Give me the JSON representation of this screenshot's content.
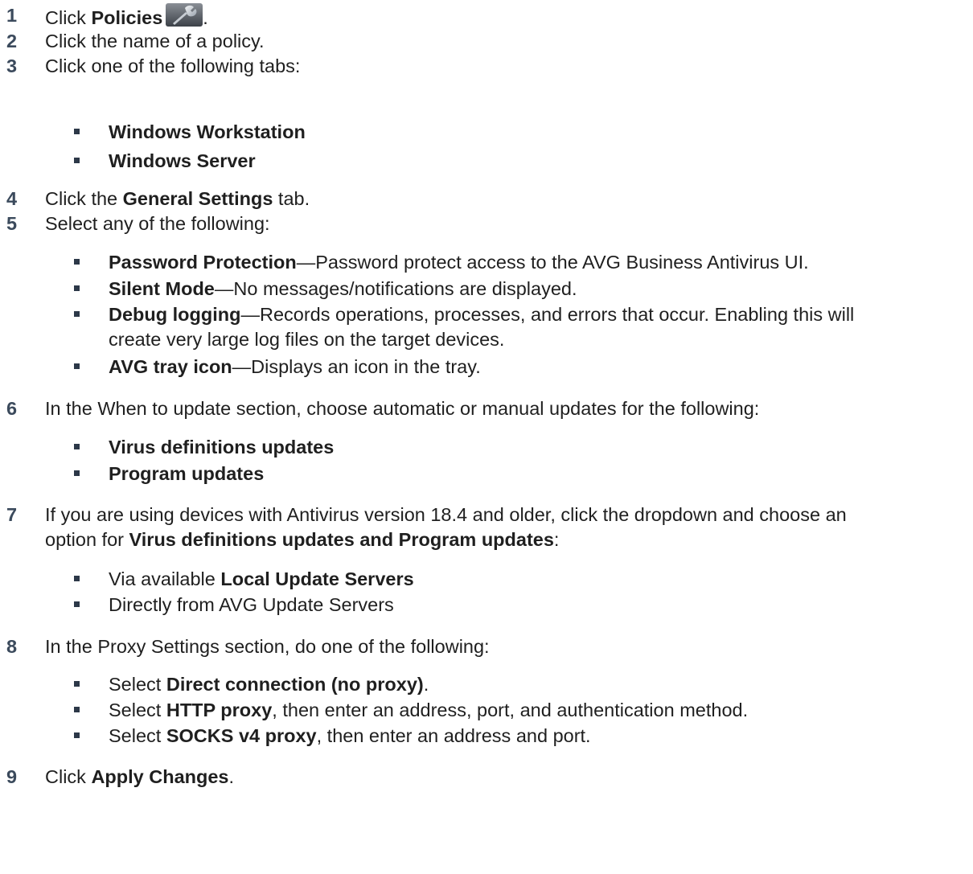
{
  "steps": [
    {
      "n": "1",
      "pre": "Click ",
      "b1": "Policies",
      "post": "."
    },
    {
      "n": "2",
      "text": "Click the name of a policy."
    },
    {
      "n": "3",
      "text": "Click one of the following tabs:",
      "bullets": [
        {
          "b": "Windows Workstation"
        },
        {
          "b": "Windows Server"
        }
      ]
    },
    {
      "n": "4",
      "pre": "Click the ",
      "b1": "General Settings",
      "post": " tab."
    },
    {
      "n": "5",
      "text": "Select any of the following:",
      "bullets": [
        {
          "b": "Password Protection",
          "rest": "—Password protect access to the AVG Business Antivirus UI."
        },
        {
          "b": "Silent Mode",
          "rest": "—No messages/notifications are displayed."
        },
        {
          "b": "Debug logging",
          "rest": "—Records operations, processes, and errors that occur. Enabling this will",
          "rest2": "create very large log files on the target devices."
        },
        {
          "b": "AVG tray icon",
          "rest": "—Displays an icon in the tray."
        }
      ]
    },
    {
      "n": "6",
      "text": "In the When to update section, choose automatic or manual updates for the following:",
      "bullets": [
        {
          "b": "Virus definitions updates"
        },
        {
          "b": "Program updates"
        }
      ]
    },
    {
      "n": "7",
      "line1": "If you are using devices with Antivirus version 18.4 and older, click the dropdown and choose an",
      "line2pre": "option for ",
      "line2b": "Virus definitions updates and Program updates",
      "line2post": ":",
      "bullets": [
        {
          "pre": "Via available ",
          "b": "Local Update Servers"
        },
        {
          "pre": "Directly from AVG Update Servers"
        }
      ]
    },
    {
      "n": "8",
      "text": "In the Proxy Settings section, do one of the following:",
      "bullets": [
        {
          "pre": "Select ",
          "b": "Direct connection (no proxy)",
          "rest": "."
        },
        {
          "pre": "Select ",
          "b": "HTTP proxy",
          "rest": ", then enter an address, port, and authentication method."
        },
        {
          "pre": "Select ",
          "b": "SOCKS v4 proxy",
          "rest": ", then enter an address and port."
        }
      ]
    },
    {
      "n": "9",
      "pre": "Click ",
      "b1": "Apply Changes",
      "post": "."
    }
  ],
  "icons": {
    "policies": "wrench-icon"
  }
}
